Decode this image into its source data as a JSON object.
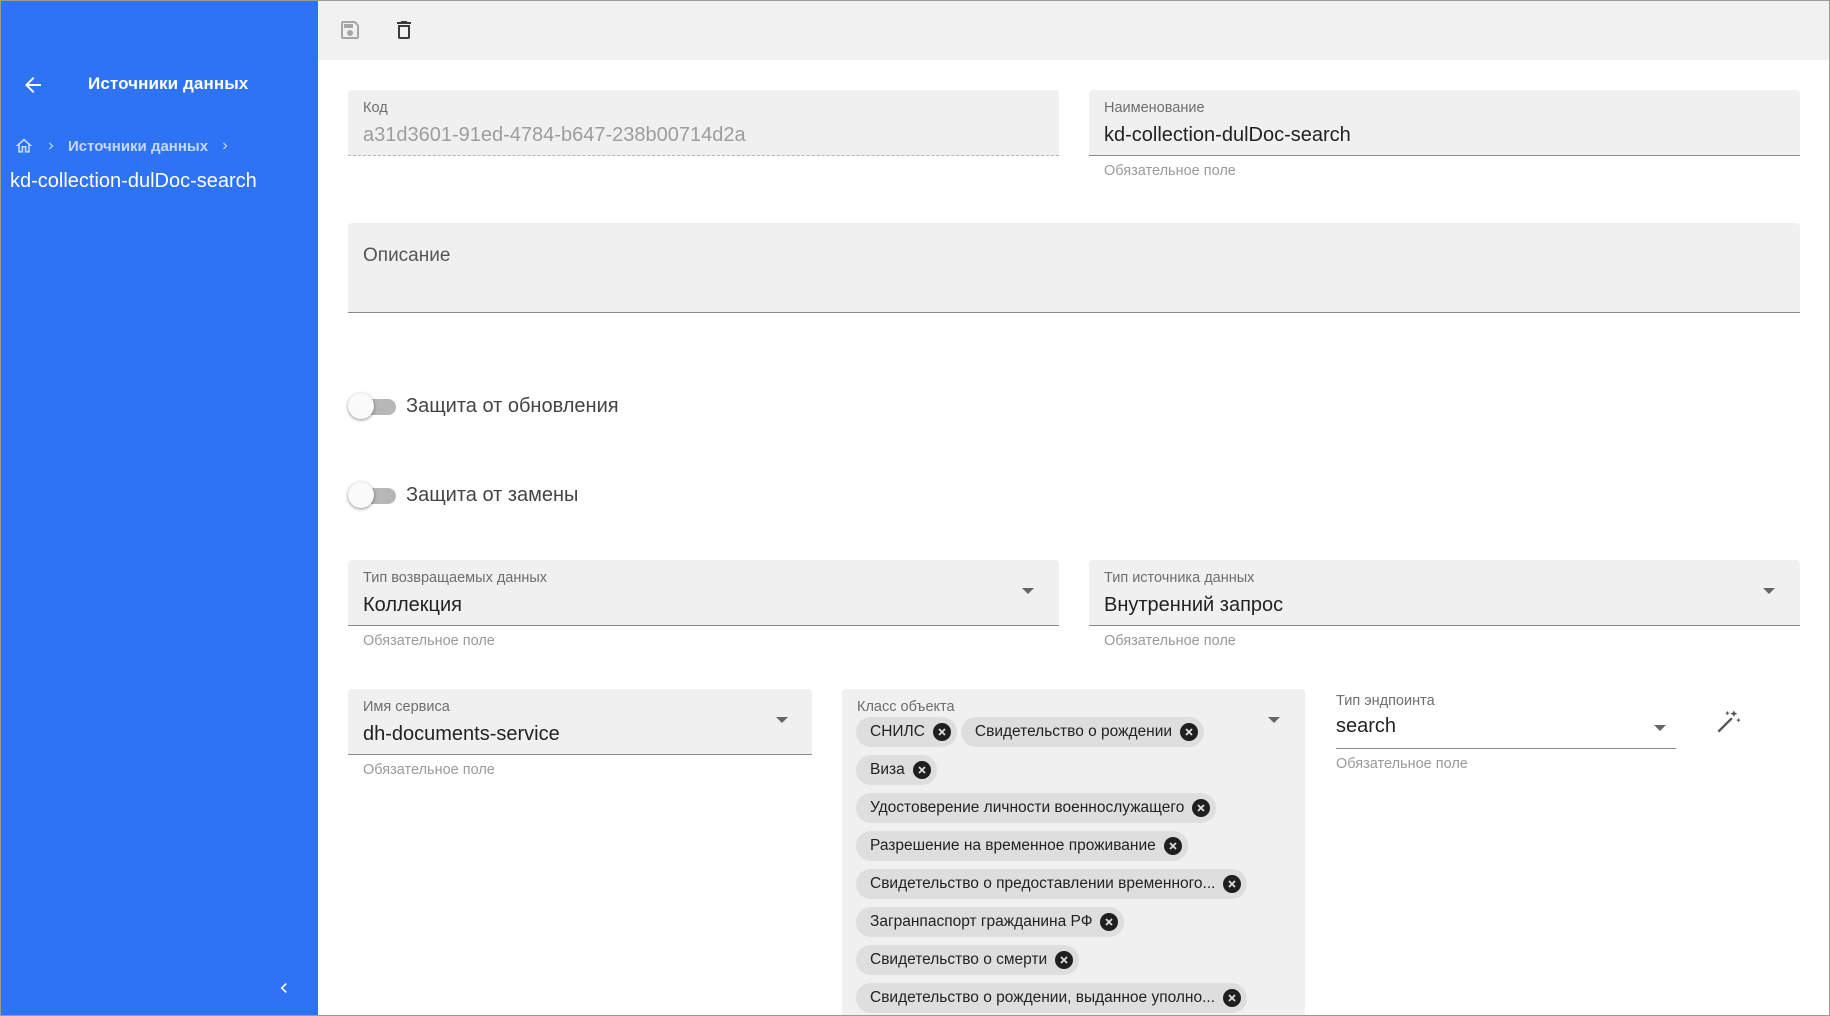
{
  "sidebar": {
    "title": "Источники данных",
    "breadcrumb": [
      "Источники данных"
    ],
    "current": "kd-collection-dulDoc-search"
  },
  "icons": {
    "back": "arrow-left-icon",
    "home": "home-icon",
    "chevron": "chevron-right-icon",
    "collapse": "chevron-left-icon",
    "save": "save-icon",
    "delete": "trash-icon",
    "dropdown": "caret-down-icon",
    "chip_remove": "close-circle-icon",
    "magic": "magic-wand-icon"
  },
  "form": {
    "code": {
      "label": "Код",
      "value": "a31d3601-91ed-4784-b647-238b00714d2a"
    },
    "name": {
      "label": "Наименование",
      "value": "kd-collection-dulDoc-search",
      "hint": "Обязательное поле"
    },
    "description": {
      "label": "Описание"
    },
    "protect_update": {
      "label": "Защита от обновления",
      "on": false
    },
    "protect_replace": {
      "label": "Защита от замены",
      "on": false
    },
    "return_type": {
      "label": "Тип возвращаемых данных",
      "value": "Коллекция",
      "hint": "Обязательное поле"
    },
    "source_type": {
      "label": "Тип источника данных",
      "value": "Внутренний запрос",
      "hint": "Обязательное поле"
    },
    "service_name": {
      "label": "Имя сервиса",
      "value": "dh-documents-service",
      "hint": "Обязательное поле"
    },
    "object_class": {
      "label": "Класс объекта",
      "chips": [
        "СНИЛС",
        "Свидетельство о рождении",
        "Виза",
        "Удостоверение личности военнослужащего",
        "Разрешение на временное проживание",
        "Свидетельство о предоставлении временного...",
        "Загранпаспорт гражданина РФ",
        "Свидетельство о смерти",
        "Свидетельство о рождении, выданное уполно..."
      ]
    },
    "endpoint_type": {
      "label": "Тип эндпоинта",
      "value": "search",
      "hint": "Обязательное поле"
    }
  },
  "colors": {
    "sidebar_bg": "#2f73f5",
    "field_bg": "#f0f0f0",
    "toolbar_bg": "#f1f1f1",
    "chip_bg": "#dedede"
  }
}
